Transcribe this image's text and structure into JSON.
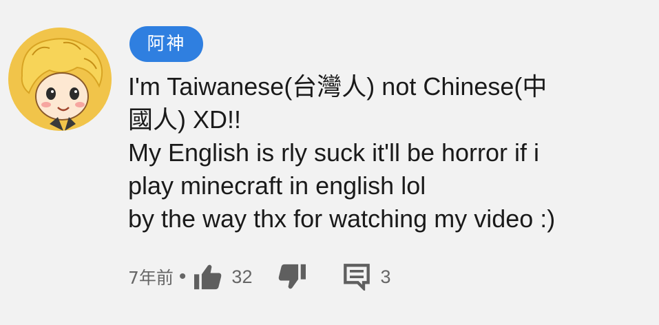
{
  "comment": {
    "author": "阿神",
    "text_lines": [
      "I'm Taiwanese(台灣人) not Chinese(中",
      "國人) XD!!",
      "My English is rly suck it'll be horror if i",
      "play minecraft in english lol",
      "by the way thx for watching my video :)"
    ],
    "timestamp": "7年前",
    "separator": "•",
    "like_count": "32",
    "reply_count": "3"
  },
  "icons": {
    "avatar": "cartoon-avatar",
    "like": "thumbs-up-icon",
    "dislike": "thumbs-down-icon",
    "reply": "comment-icon"
  },
  "colors": {
    "author_badge": "#2f7fe0",
    "text": "#1a1a1a",
    "meta": "#666666",
    "background": "#f2f2f2"
  }
}
